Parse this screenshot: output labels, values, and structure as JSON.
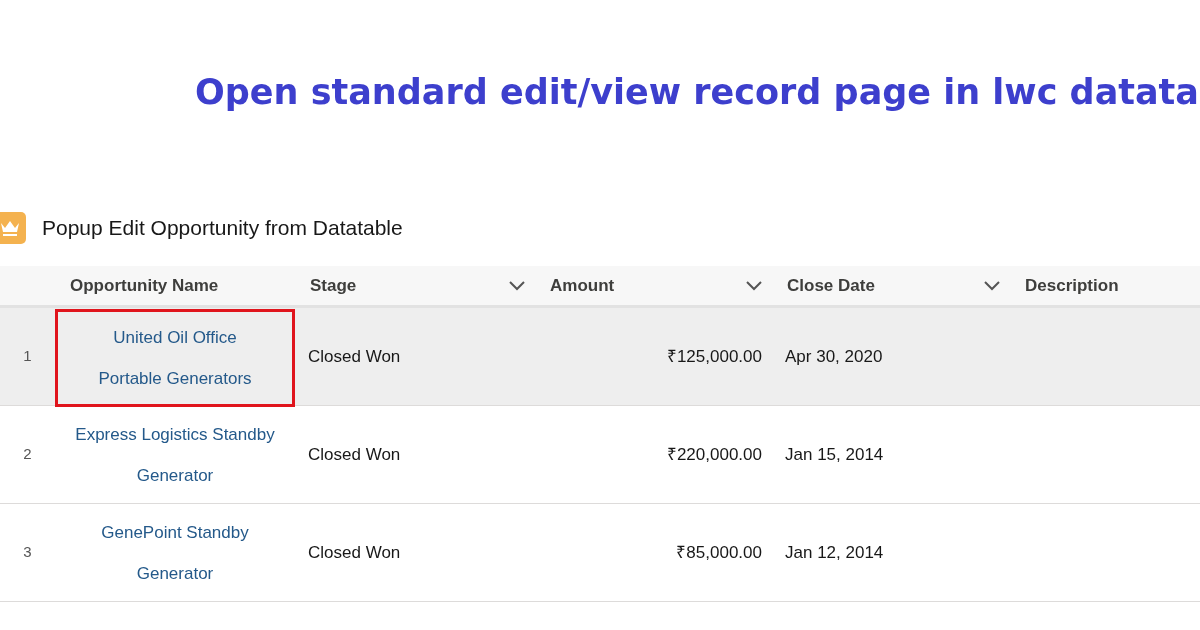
{
  "banner": {
    "title": "Open standard edit/view record page in lwc datata"
  },
  "card": {
    "title": "Popup Edit Opportunity from Datatable"
  },
  "table": {
    "columns": [
      {
        "label": "Opportunity Name",
        "menu": false
      },
      {
        "label": "Stage",
        "menu": true
      },
      {
        "label": "Amount",
        "menu": true
      },
      {
        "label": "Close Date",
        "menu": true
      },
      {
        "label": "Description",
        "menu": false
      }
    ],
    "rows": [
      {
        "number": "1",
        "name": [
          "United Oil Office",
          "Portable Generators"
        ],
        "stage": "Closed Won",
        "amount": "₹125,000.00",
        "close_date": "Apr 30, 2020",
        "selected": true,
        "highlighted": true
      },
      {
        "number": "2",
        "name": [
          "Express Logistics Standby",
          "Generator"
        ],
        "stage": "Closed Won",
        "amount": "₹220,000.00",
        "close_date": "Jan 15, 2014",
        "selected": false,
        "highlighted": false
      },
      {
        "number": "3",
        "name": [
          "GenePoint Standby",
          "Generator"
        ],
        "stage": "Closed Won",
        "amount": "₹85,000.00",
        "close_date": "Jan 12, 2014",
        "selected": false,
        "highlighted": false
      }
    ]
  }
}
